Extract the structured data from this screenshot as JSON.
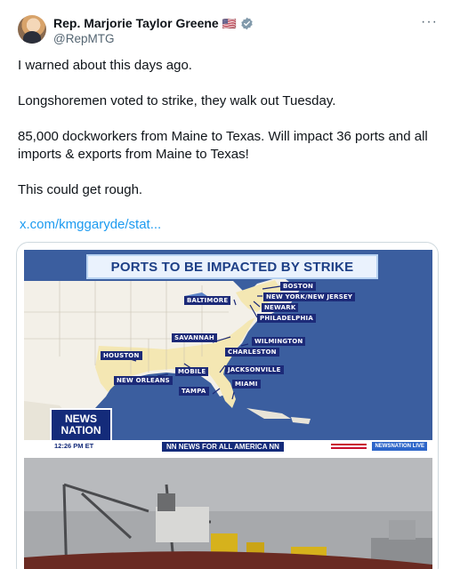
{
  "author": {
    "name": "Rep. Marjorie Taylor Greene",
    "flag": "🇺🇸",
    "handle": "@RepMTG",
    "more_label": "···"
  },
  "post": {
    "paragraphs": [
      "I warned about this days ago.",
      "Longshoremen voted to strike, they walk out Tuesday.",
      "85,000 dockworkers from Maine to Texas. Will impact 36 ports and all imports & exports from Maine to Texas!",
      "This could get rough."
    ],
    "link": "x.com/kmggaryde/stat..."
  },
  "media": {
    "map": {
      "title": "PORTS TO BE IMPACTED BY STRIKE",
      "ports": [
        "BOSTON",
        "NEW YORK/NEW JERSEY",
        "NEWARK",
        "PHILADELPHIA",
        "BALTIMORE",
        "SAVANNAH",
        "WILMINGTON",
        "CHARLESTON",
        "HOUSTON",
        "MOBILE",
        "JACKSONVILLE",
        "NEW ORLEANS",
        "MIAMI",
        "TAMPA"
      ],
      "network_logo": [
        "NEWS",
        "NATION"
      ],
      "time": "12:26 PM ET",
      "ticker": "NN NEWS FOR ALL AMERICA NN",
      "live_badge": "NEWSNATION LIVE"
    },
    "colors": {
      "ocean": "#3b5e9f",
      "land": "#f3f0e8",
      "impacted_states": "#f4e7b3",
      "label_bg": "#1c2a78",
      "link": "#1d9bf0"
    }
  }
}
